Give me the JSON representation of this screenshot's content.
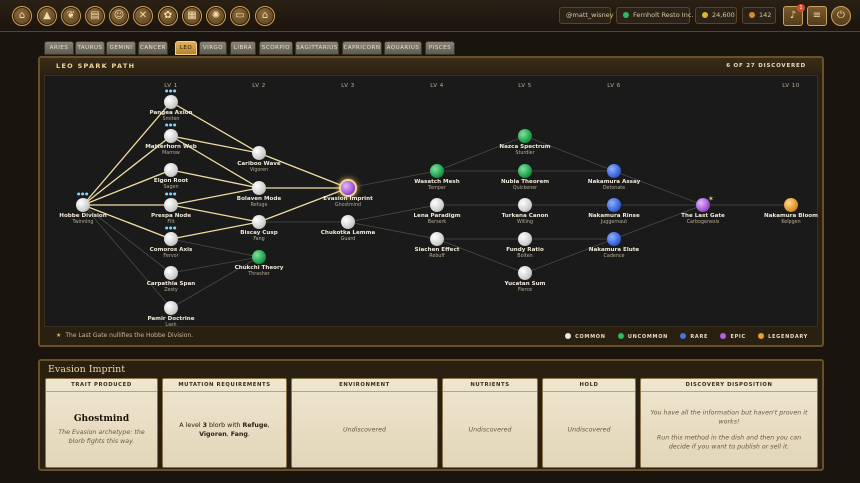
{
  "topbar": {
    "nav_icons": [
      "home-icon",
      "flask-icon",
      "leaf-icon",
      "book-icon",
      "chart-icon",
      "tools-icon",
      "gift-icon",
      "grid-icon",
      "settings-icon",
      "puzzle-icon",
      "shop-icon"
    ],
    "username": "@matt_wisney",
    "company": "Fernholt Resto Inc.",
    "coins": "24,600",
    "gems": "142",
    "notification_count": "1"
  },
  "tabs": [
    {
      "label": "ARIES",
      "active": false
    },
    {
      "label": "TAURUS",
      "active": false
    },
    {
      "label": "GEMINI",
      "active": false
    },
    {
      "label": "CANCER",
      "active": false
    },
    {
      "label": "LEO",
      "active": true
    },
    {
      "label": "VIRGO",
      "active": false
    },
    {
      "label": "LIBRA",
      "active": false
    },
    {
      "label": "SCORPIO",
      "active": false
    },
    {
      "label": "SAGITTARIUS",
      "active": false
    },
    {
      "label": "CAPRICORN",
      "active": false
    },
    {
      "label": "AQUARIUS",
      "active": false
    },
    {
      "label": "PISCES",
      "active": false
    }
  ],
  "spark": {
    "title": "LEO SPARK PATH",
    "discovered": "6 OF 27 DISCOVERED",
    "levels": [
      "LV 1",
      "LV 2",
      "LV 3",
      "LV 4",
      "LV 5",
      "LV 6",
      "LV 10"
    ],
    "footnote": "The Last Gate nullifies the Hobbe Division.",
    "legend": [
      {
        "label": "COMMON",
        "color": "#e8e8e8"
      },
      {
        "label": "UNCOMMON",
        "color": "#2fb85c"
      },
      {
        "label": "RARE",
        "color": "#4a70e0"
      },
      {
        "label": "EPIC",
        "color": "#b060e0"
      },
      {
        "label": "LEGENDARY",
        "color": "#e8a030"
      }
    ],
    "nodes": [
      {
        "id": "hobbe",
        "name": "Hobbe Division",
        "sub": "Twinning",
        "rarity": "common",
        "stars": true
      },
      {
        "id": "pangea",
        "name": "Pangea Axion",
        "sub": "Smiten",
        "rarity": "common",
        "stars": true
      },
      {
        "id": "matterhorn",
        "name": "Matterhorn Web",
        "sub": "Marrow",
        "rarity": "common",
        "stars": true
      },
      {
        "id": "elgon",
        "name": "Elgon Root",
        "sub": "Sagen",
        "rarity": "common",
        "stars": false
      },
      {
        "id": "prespa",
        "name": "Prespa Node",
        "sub": "Flit",
        "rarity": "common",
        "stars": true
      },
      {
        "id": "comoros",
        "name": "Comoros Axis",
        "sub": "Fervor",
        "rarity": "common",
        "stars": true
      },
      {
        "id": "carpathia",
        "name": "Carpathia Span",
        "sub": "Zesty",
        "rarity": "common",
        "stars": false
      },
      {
        "id": "pamir",
        "name": "Pamir Doctrine",
        "sub": "Lash",
        "rarity": "common",
        "stars": false
      },
      {
        "id": "cariboo",
        "name": "Cariboo Wave",
        "sub": "Vigoren",
        "rarity": "common",
        "stars": false
      },
      {
        "id": "bolaven",
        "name": "Bolaven Mode",
        "sub": "Refuge",
        "rarity": "common",
        "stars": false
      },
      {
        "id": "biscay",
        "name": "Biscay Cusp",
        "sub": "Fang",
        "rarity": "common",
        "stars": false
      },
      {
        "id": "chukchi",
        "name": "Chukchi Theory",
        "sub": "Thrasher",
        "rarity": "uncommon",
        "stars": false
      },
      {
        "id": "evasion",
        "name": "Evasion Imprint",
        "sub": "Ghostmind",
        "rarity": "epic",
        "stars": false,
        "selected": true
      },
      {
        "id": "chukotka",
        "name": "Chukotka Lemma",
        "sub": "Guard",
        "rarity": "common",
        "stars": false
      },
      {
        "id": "wasatch",
        "name": "Wasatch Mesh",
        "sub": "Temper",
        "rarity": "uncommon",
        "stars": false
      },
      {
        "id": "lena",
        "name": "Lena Paradigm",
        "sub": "Berserk",
        "rarity": "common",
        "stars": false
      },
      {
        "id": "siachen",
        "name": "Siachen Effect",
        "sub": "Rebuff",
        "rarity": "common",
        "stars": false
      },
      {
        "id": "nazca",
        "name": "Nazca Spectrum",
        "sub": "Sturdier",
        "rarity": "uncommon",
        "stars": false
      },
      {
        "id": "nubia",
        "name": "Nubia Theorem",
        "sub": "Quickener",
        "rarity": "uncommon",
        "stars": false
      },
      {
        "id": "turkana",
        "name": "Turkana Canon",
        "sub": "Willing",
        "rarity": "common",
        "stars": false
      },
      {
        "id": "fundy",
        "name": "Fundy Ratio",
        "sub": "Bolten",
        "rarity": "common",
        "stars": false
      },
      {
        "id": "yucatan",
        "name": "Yucatan Sum",
        "sub": "Fierce",
        "rarity": "common",
        "stars": false
      },
      {
        "id": "assay",
        "name": "Nakamura Assay",
        "sub": "Detonate",
        "rarity": "rare",
        "stars": false
      },
      {
        "id": "rinse",
        "name": "Nakamura Rinse",
        "sub": "Juggernaut",
        "rarity": "rare",
        "stars": false
      },
      {
        "id": "elute",
        "name": "Nakamura Elute",
        "sub": "Cadence",
        "rarity": "rare",
        "stars": false
      },
      {
        "id": "lastgate",
        "name": "The Last Gate",
        "sub": "Carbogenesis",
        "rarity": "epic",
        "stars": false
      },
      {
        "id": "bloom",
        "name": "Nakamura Bloom",
        "sub": "Kelpgen",
        "rarity": "legendary",
        "stars": false
      }
    ]
  },
  "detail": {
    "title": "Evasion Imprint",
    "trait": {
      "header": "TRAIT PRODUCED",
      "name": "Ghostmind",
      "desc": "The Evasion archetype: the blorb fights this way."
    },
    "mutation": {
      "header": "MUTATION REQUIREMENTS",
      "pre": "A level ",
      "level": "3",
      "mid": " blorb with ",
      "t1": "Refuge",
      "sep1": ", ",
      "t2": "Vigoren",
      "sep2": ", ",
      "t3": "Fang",
      "end": "."
    },
    "environment": {
      "header": "ENVIRONMENT",
      "value": "Undiscovered"
    },
    "nutrients": {
      "header": "NUTRIENTS",
      "value": "Undiscovered"
    },
    "hold": {
      "header": "HOLD",
      "value": "Undiscovered"
    },
    "disposition": {
      "header": "DISCOVERY DISPOSITION",
      "line1": "You have all the information but haven't proven it works!",
      "line2": "Run this method in the dish and then you can decide if you want to publish or sell it."
    }
  }
}
